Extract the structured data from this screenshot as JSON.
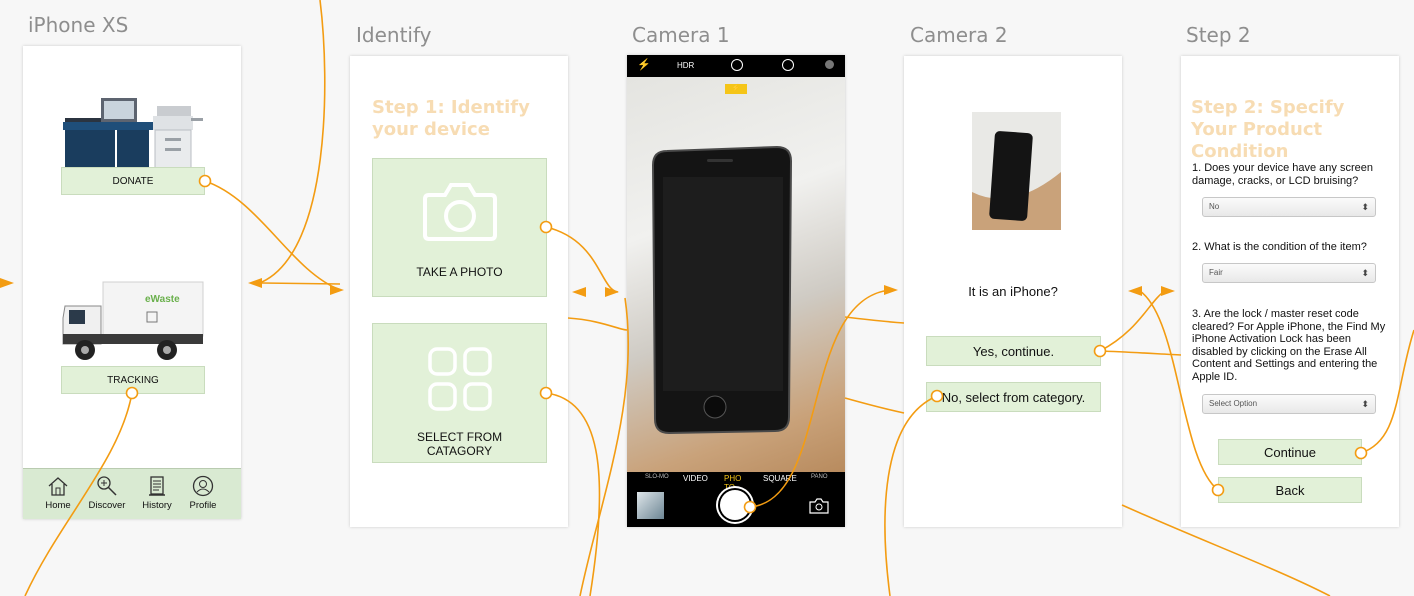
{
  "artboards": {
    "iphone_xs": {
      "title": "iPhone XS",
      "donate_label": "DONATE",
      "tracking_label": "TRACKING",
      "truck_logo": "eWaste",
      "tabs": [
        {
          "label": "Home",
          "icon": "home-icon"
        },
        {
          "label": "Discover",
          "icon": "discover-icon"
        },
        {
          "label": "History",
          "icon": "history-icon"
        },
        {
          "label": "Profile",
          "icon": "profile-icon"
        }
      ]
    },
    "identify": {
      "title": "Identify",
      "heading": "Step 1: Identify your device",
      "take_photo_label": "TAKE A PHOTO",
      "select_category_label": "SELECT FROM CATAGORY"
    },
    "camera1": {
      "title": "Camera 1",
      "hdr_label": "HDR",
      "modes": [
        "SLO-MO",
        "VIDEO",
        "PHOTO",
        "SQUARE",
        "PANO"
      ],
      "active_mode": "PHOTO"
    },
    "camera2": {
      "title": "Camera 2",
      "question": "It is an iPhone?",
      "yes_label": "Yes, continue.",
      "no_label": "No, select from category."
    },
    "step2": {
      "title": "Step 2",
      "heading": "Step 2: Specify Your Product Condition",
      "q1": "1. Does your device have any screen damage, cracks, or LCD bruising?",
      "q1_value": "No",
      "q2": "2. What is the condition of the item?",
      "q2_value": "Fair",
      "q3": "3. Are the lock / master reset code cleared? For Apple iPhone, the Find My iPhone Activation Lock has been disabled by clicking on the Erase All Content and Settings and entering the Apple ID.",
      "q3_value": "Select Option",
      "continue_label": "Continue",
      "back_label": "Back"
    }
  },
  "colors": {
    "connector": "#f39c12",
    "button_fill": "#e2f1d8",
    "heading_peach": "#f7dcb3",
    "camera_yellow": "#f5c518"
  }
}
